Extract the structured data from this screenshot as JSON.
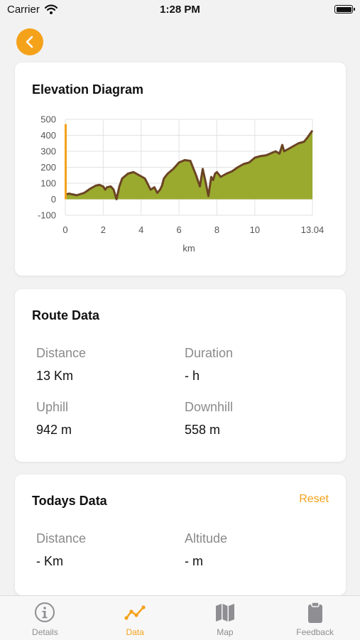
{
  "status_bar": {
    "carrier": "Carrier",
    "time": "1:28 PM"
  },
  "colors": {
    "accent": "#f5a21b",
    "fill": "#9aaa2e",
    "outline": "#6b4424",
    "start_marker": "#f5a21b",
    "inactive": "#8e8e93"
  },
  "elevation": {
    "title": "Elevation Diagram",
    "chart_data": {
      "type": "area",
      "xlabel": "km",
      "ylabel": "",
      "xlim": [
        0,
        13.04
      ],
      "ylim": [
        -100,
        500
      ],
      "x_ticks": [
        0,
        2,
        4,
        6,
        8,
        10,
        13.04
      ],
      "x_tick_labels": [
        "0",
        "2",
        "4",
        "6",
        "8",
        "10",
        "13.04"
      ],
      "y_ticks": [
        500,
        400,
        300,
        200,
        100,
        0,
        -100
      ],
      "y_tick_labels": [
        "500",
        "400",
        "300",
        "200",
        "100",
        "0",
        "-100"
      ],
      "grid": true,
      "start_marker": {
        "x": 0.05,
        "y": 470
      },
      "series": [
        {
          "x": [
            0,
            0.2,
            0.6,
            1.0,
            1.3,
            1.6,
            1.8,
            2.0,
            2.1,
            2.2,
            2.4,
            2.55,
            2.7,
            2.85,
            3.0,
            3.3,
            3.6,
            3.9,
            4.2,
            4.5,
            4.7,
            4.85,
            5.0,
            5.1,
            5.2,
            5.4,
            5.7,
            6.0,
            6.3,
            6.6,
            6.9,
            7.1,
            7.25,
            7.4,
            7.55,
            7.7,
            7.8,
            7.9,
            8.0,
            8.2,
            8.5,
            8.8,
            9.1,
            9.4,
            9.7,
            10.0,
            10.3,
            10.6,
            10.9,
            11.1,
            11.3,
            11.45,
            11.55,
            11.7,
            12.0,
            12.3,
            12.6,
            12.8,
            13.04
          ],
          "y": [
            30,
            35,
            25,
            40,
            65,
            85,
            90,
            80,
            60,
            75,
            80,
            60,
            0,
            80,
            130,
            160,
            170,
            150,
            130,
            60,
            75,
            40,
            60,
            85,
            130,
            160,
            190,
            230,
            245,
            240,
            150,
            80,
            190,
            110,
            20,
            140,
            120,
            160,
            170,
            140,
            160,
            175,
            200,
            220,
            230,
            260,
            270,
            275,
            290,
            300,
            285,
            340,
            300,
            310,
            330,
            350,
            360,
            390,
            430
          ]
        }
      ]
    }
  },
  "route": {
    "title": "Route Data",
    "distance_label": "Distance",
    "distance_value": "13 Km",
    "duration_label": "Duration",
    "duration_value": "- h",
    "uphill_label": "Uphill",
    "uphill_value": "942 m",
    "downhill_label": "Downhill",
    "downhill_value": "558 m"
  },
  "today": {
    "title": "Todays Data",
    "reset_label": "Reset",
    "distance_label": "Distance",
    "distance_value": "- Km",
    "altitude_label": "Altitude",
    "altitude_value": "- m"
  },
  "tabs": [
    {
      "label": "Details",
      "icon": "info-circle-icon"
    },
    {
      "label": "Data",
      "icon": "line-graph-icon"
    },
    {
      "label": "Map",
      "icon": "map-icon"
    },
    {
      "label": "Feedback",
      "icon": "clipboard-icon"
    }
  ]
}
